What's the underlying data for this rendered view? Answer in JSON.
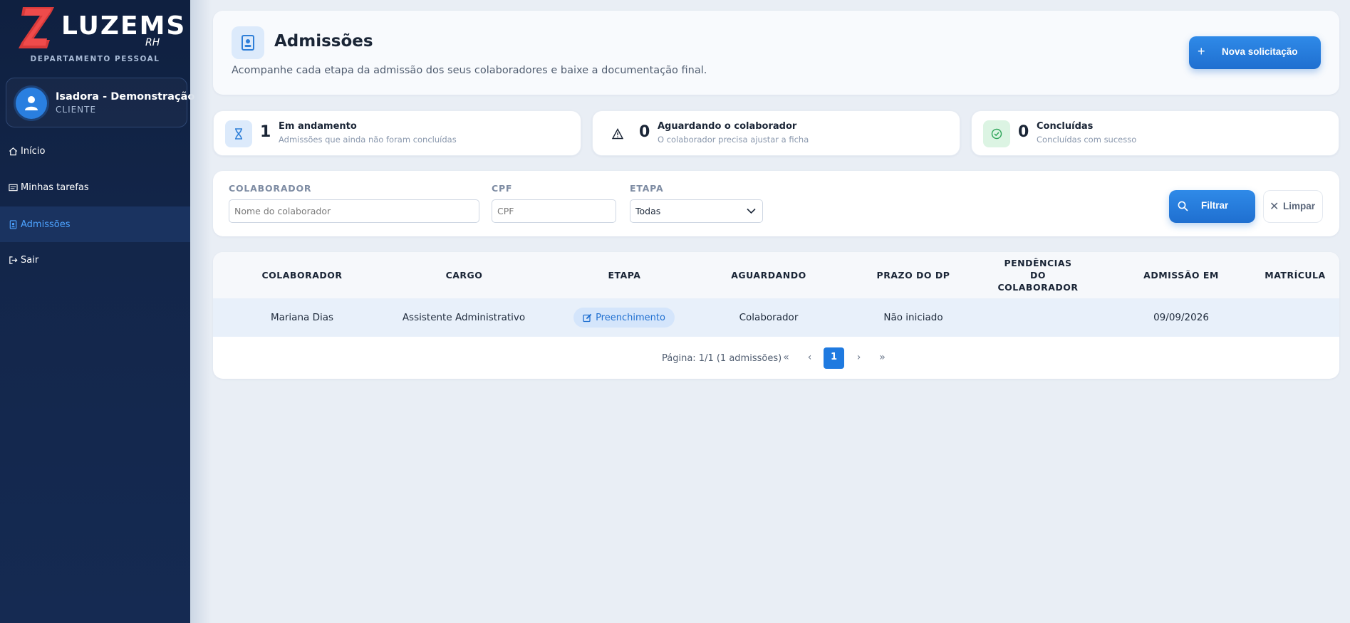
{
  "brand": {
    "name": "LUZEMS",
    "suffix": "RH",
    "department": "DEPARTAMENTO PESSOAL",
    "accent_color": "#e23b3b"
  },
  "user": {
    "name": "Isadora - Demonstração",
    "role": "CLIENTE"
  },
  "sidebar": {
    "items": [
      {
        "label": "Início",
        "icon": "home-icon",
        "active": false
      },
      {
        "label": "Minhas tarefas",
        "icon": "tasks-icon",
        "active": false
      },
      {
        "label": "Admissões",
        "icon": "badge-icon",
        "active": true
      },
      {
        "label": "Sair",
        "icon": "logout-icon",
        "active": false
      }
    ]
  },
  "header": {
    "title": "Admissões",
    "subtitle": "Acompanhe cada etapa da admissão dos seus colaboradores e baixe a documentação final.",
    "new_button": "Nova solicitação"
  },
  "stats": [
    {
      "value": "1",
      "title": "Em andamento",
      "description": "Admissões que ainda não foram concluídas",
      "icon": "hourglass-icon",
      "color": "#2f7fd8"
    },
    {
      "value": "0",
      "title": "Aguardando o colaborador",
      "description": "O colaborador precisa ajustar a ficha",
      "icon": "warning-icon",
      "color": "#1a2536"
    },
    {
      "value": "0",
      "title": "Concluídas",
      "description": "Concluídas com sucesso",
      "icon": "check-circle-icon",
      "color": "#2fa55a"
    }
  ],
  "filters": {
    "colaborador": {
      "label": "COLABORADOR",
      "placeholder": "Nome do colaborador"
    },
    "cpf": {
      "label": "CPF",
      "placeholder": "CPF"
    },
    "etapa": {
      "label": "ETAPA",
      "value": "Todas"
    },
    "filter_button": "Filtrar",
    "clear_button": "Limpar"
  },
  "table": {
    "columns": [
      "COLABORADOR",
      "CARGO",
      "ETAPA",
      "AGUARDANDO",
      "PRAZO DO DP",
      "PENDÊNCIAS DO COLABORADOR",
      "ADMISSÃO EM",
      "MATRÍCULA"
    ],
    "rows": [
      {
        "colaborador": "Mariana Dias",
        "cargo": "Assistente Administrativo",
        "etapa": "Preenchimento",
        "aguardando": "Colaborador",
        "prazo": "Não iniciado",
        "pendencias": "",
        "admissao": "09/09/2026",
        "matricula": ""
      }
    ]
  },
  "pagination": {
    "summary": "Página: 1/1 (1 admissões)",
    "first": "«",
    "prev": "‹",
    "current": "1",
    "next": "›",
    "last": "»"
  }
}
